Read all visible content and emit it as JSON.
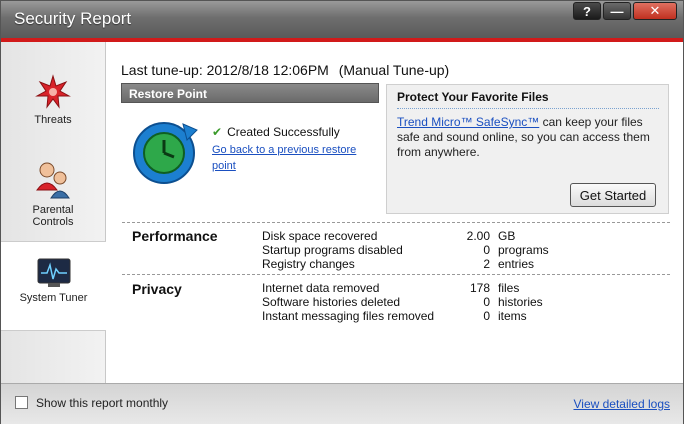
{
  "window": {
    "title": "Security Report",
    "help_label": "?",
    "minimize_label": "—",
    "close_label": "✕"
  },
  "sidebar": {
    "items": [
      {
        "label": "Threats",
        "icon": "threats-icon"
      },
      {
        "label": "Parental Controls",
        "icon": "parental-controls-icon"
      },
      {
        "label": "System Tuner",
        "icon": "system-tuner-icon"
      }
    ]
  },
  "main": {
    "last_tuneup": "Last tune-up: 2012/8/18  12:06PM",
    "tuneup_mode": "(Manual Tune-up)",
    "restore": {
      "header": "Restore Point",
      "status": "Created Successfully",
      "link": "Go back to a previous restore point"
    },
    "protect": {
      "title": "Protect Your Favorite Files",
      "link": "Trend Micro™ SafeSync™",
      "text": " can keep your files safe and sound online, so you can access them from anywhere.",
      "button": "Get Started"
    },
    "performance": {
      "title": "Performance",
      "rows": [
        {
          "label": "Disk space recovered",
          "value": "2.00",
          "unit": "GB"
        },
        {
          "label": "Startup programs disabled",
          "value": "0",
          "unit": "programs"
        },
        {
          "label": "Registry changes",
          "value": "2",
          "unit": "entries"
        }
      ]
    },
    "privacy": {
      "title": "Privacy",
      "rows": [
        {
          "label": "Internet data removed",
          "value": "178",
          "unit": "files"
        },
        {
          "label": "Software histories deleted",
          "value": "0",
          "unit": "histories"
        },
        {
          "label": "Instant messaging files removed",
          "value": "0",
          "unit": "items"
        }
      ]
    }
  },
  "footer": {
    "checkbox_label": "Show this report monthly",
    "checkbox_checked": false,
    "logs_link": "View detailed logs"
  },
  "colors": {
    "accent_red": "#d11a1a",
    "link_blue": "#1a4fc0"
  }
}
